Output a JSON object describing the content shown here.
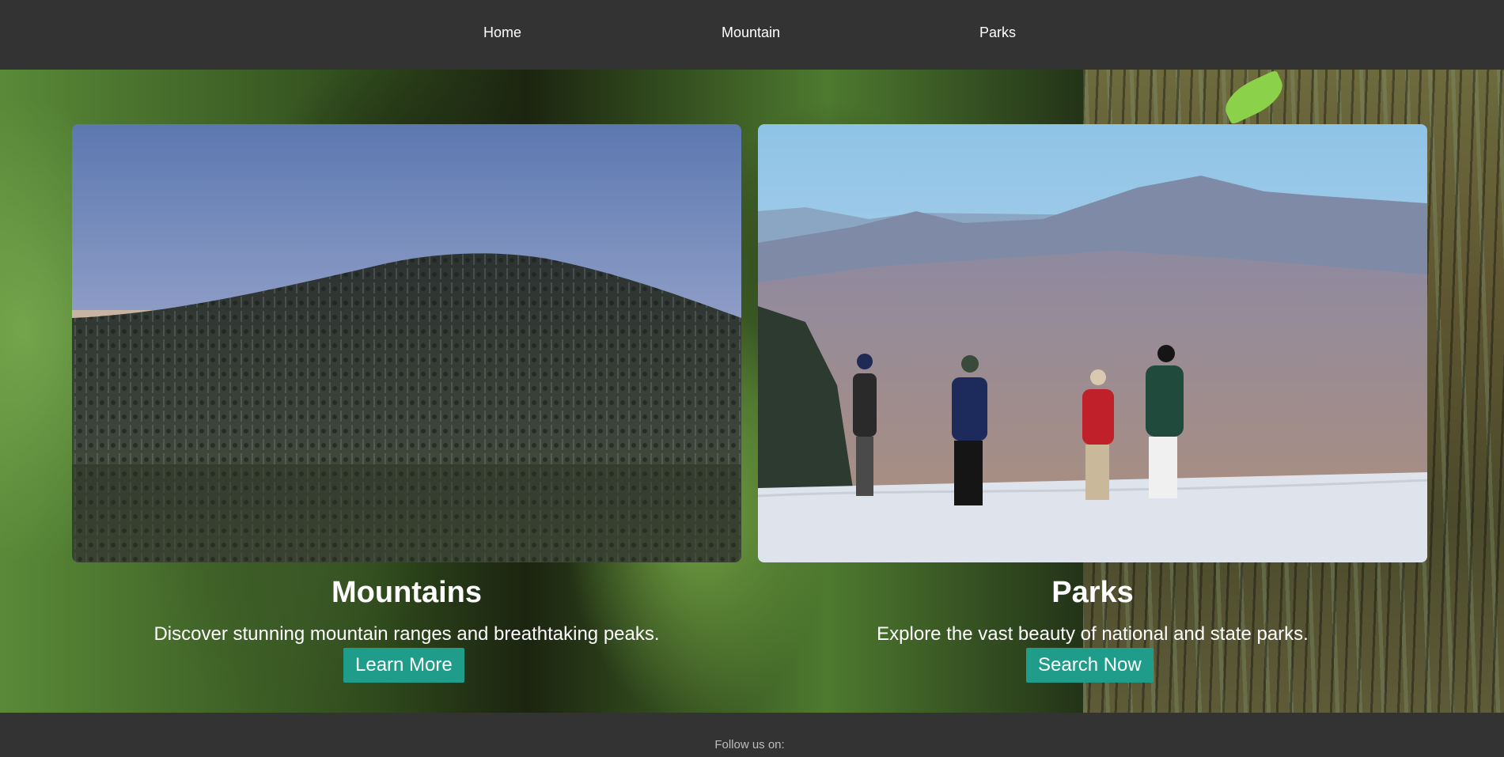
{
  "nav": {
    "items": [
      {
        "label": "Home"
      },
      {
        "label": "Mountain"
      },
      {
        "label": "Parks"
      }
    ]
  },
  "cards": [
    {
      "title": "Mountains",
      "description": "Discover stunning mountain ranges and breathtaking peaks.",
      "button_label": "Learn More"
    },
    {
      "title": "Parks",
      "description": "Explore the vast beauty of national and state parks.",
      "button_label": "Search Now"
    }
  ],
  "footer": {
    "text": "Follow us on:"
  },
  "colors": {
    "bar_background": "#333333",
    "button": "#1f9d8a"
  }
}
